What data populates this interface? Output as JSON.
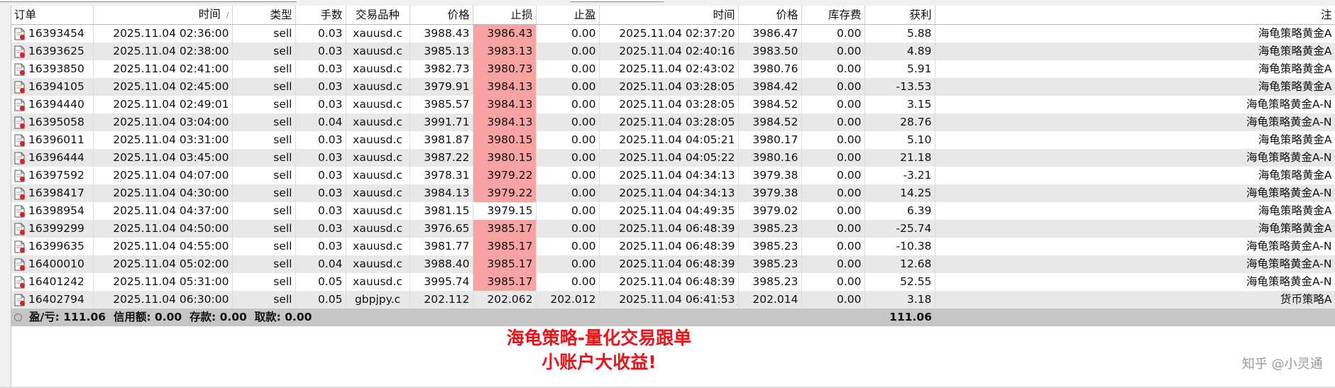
{
  "columns": [
    "订单",
    "时间",
    "类型",
    "手数",
    "交易品种",
    "价格",
    "止损",
    "止盈",
    "时间",
    "价格",
    "库存费",
    "获利",
    "注"
  ],
  "sort_indicator": "/",
  "rows": [
    {
      "order": "16393454",
      "open_time": "2025.11.04 02:36:00",
      "type": "sell",
      "lots": "0.03",
      "symbol": "xauusd.c",
      "open_price": "3988.43",
      "sl": "3986.43",
      "tp": "0.00",
      "close_time": "2025.11.04 02:37:20",
      "close_price": "3986.47",
      "swap": "0.00",
      "profit": "5.88",
      "comment": "海龟策略黄金A",
      "sl_hit": true
    },
    {
      "order": "16393625",
      "open_time": "2025.11.04 02:38:00",
      "type": "sell",
      "lots": "0.03",
      "symbol": "xauusd.c",
      "open_price": "3985.13",
      "sl": "3983.13",
      "tp": "0.00",
      "close_time": "2025.11.04 02:40:16",
      "close_price": "3983.50",
      "swap": "0.00",
      "profit": "4.89",
      "comment": "海龟策略黄金A",
      "sl_hit": true
    },
    {
      "order": "16393850",
      "open_time": "2025.11.04 02:41:00",
      "type": "sell",
      "lots": "0.03",
      "symbol": "xauusd.c",
      "open_price": "3982.73",
      "sl": "3980.73",
      "tp": "0.00",
      "close_time": "2025.11.04 02:43:02",
      "close_price": "3980.76",
      "swap": "0.00",
      "profit": "5.91",
      "comment": "海龟策略黄金A",
      "sl_hit": true
    },
    {
      "order": "16394105",
      "open_time": "2025.11.04 02:45:00",
      "type": "sell",
      "lots": "0.03",
      "symbol": "xauusd.c",
      "open_price": "3979.91",
      "sl": "3984.13",
      "tp": "0.00",
      "close_time": "2025.11.04 03:28:05",
      "close_price": "3984.42",
      "swap": "0.00",
      "profit": "-13.53",
      "comment": "海龟策略黄金A",
      "sl_hit": true
    },
    {
      "order": "16394440",
      "open_time": "2025.11.04 02:49:01",
      "type": "sell",
      "lots": "0.03",
      "symbol": "xauusd.c",
      "open_price": "3985.57",
      "sl": "3984.13",
      "tp": "0.00",
      "close_time": "2025.11.04 03:28:05",
      "close_price": "3984.52",
      "swap": "0.00",
      "profit": "3.15",
      "comment": "海龟策略黄金A-N",
      "sl_hit": true
    },
    {
      "order": "16395058",
      "open_time": "2025.11.04 03:04:00",
      "type": "sell",
      "lots": "0.04",
      "symbol": "xauusd.c",
      "open_price": "3991.71",
      "sl": "3984.13",
      "tp": "0.00",
      "close_time": "2025.11.04 03:28:05",
      "close_price": "3984.52",
      "swap": "0.00",
      "profit": "28.76",
      "comment": "海龟策略黄金A-N",
      "sl_hit": true
    },
    {
      "order": "16396011",
      "open_time": "2025.11.04 03:31:00",
      "type": "sell",
      "lots": "0.03",
      "symbol": "xauusd.c",
      "open_price": "3981.87",
      "sl": "3980.15",
      "tp": "0.00",
      "close_time": "2025.11.04 04:05:21",
      "close_price": "3980.17",
      "swap": "0.00",
      "profit": "5.10",
      "comment": "海龟策略黄金A",
      "sl_hit": true
    },
    {
      "order": "16396444",
      "open_time": "2025.11.04 03:45:00",
      "type": "sell",
      "lots": "0.03",
      "symbol": "xauusd.c",
      "open_price": "3987.22",
      "sl": "3980.15",
      "tp": "0.00",
      "close_time": "2025.11.04 04:05:22",
      "close_price": "3980.16",
      "swap": "0.00",
      "profit": "21.18",
      "comment": "海龟策略黄金A-N",
      "sl_hit": true
    },
    {
      "order": "16397592",
      "open_time": "2025.11.04 04:07:00",
      "type": "sell",
      "lots": "0.03",
      "symbol": "xauusd.c",
      "open_price": "3978.31",
      "sl": "3979.22",
      "tp": "0.00",
      "close_time": "2025.11.04 04:34:13",
      "close_price": "3979.38",
      "swap": "0.00",
      "profit": "-3.21",
      "comment": "海龟策略黄金A",
      "sl_hit": true
    },
    {
      "order": "16398417",
      "open_time": "2025.11.04 04:30:00",
      "type": "sell",
      "lots": "0.03",
      "symbol": "xauusd.c",
      "open_price": "3984.13",
      "sl": "3979.22",
      "tp": "0.00",
      "close_time": "2025.11.04 04:34:13",
      "close_price": "3979.38",
      "swap": "0.00",
      "profit": "14.25",
      "comment": "海龟策略黄金A-N",
      "sl_hit": true
    },
    {
      "order": "16398954",
      "open_time": "2025.11.04 04:37:00",
      "type": "sell",
      "lots": "0.03",
      "symbol": "xauusd.c",
      "open_price": "3981.15",
      "sl": "3979.15",
      "tp": "0.00",
      "close_time": "2025.11.04 04:49:35",
      "close_price": "3979.02",
      "swap": "0.00",
      "profit": "6.39",
      "comment": "海龟策略黄金A",
      "sl_hit": false
    },
    {
      "order": "16399299",
      "open_time": "2025.11.04 04:50:00",
      "type": "sell",
      "lots": "0.03",
      "symbol": "xauusd.c",
      "open_price": "3976.65",
      "sl": "3985.17",
      "tp": "0.00",
      "close_time": "2025.11.04 06:48:39",
      "close_price": "3985.23",
      "swap": "0.00",
      "profit": "-25.74",
      "comment": "海龟策略黄金A",
      "sl_hit": true
    },
    {
      "order": "16399635",
      "open_time": "2025.11.04 04:55:00",
      "type": "sell",
      "lots": "0.03",
      "symbol": "xauusd.c",
      "open_price": "3981.77",
      "sl": "3985.17",
      "tp": "0.00",
      "close_time": "2025.11.04 06:48:39",
      "close_price": "3985.23",
      "swap": "0.00",
      "profit": "-10.38",
      "comment": "海龟策略黄金A-N",
      "sl_hit": true
    },
    {
      "order": "16400010",
      "open_time": "2025.11.04 05:02:00",
      "type": "sell",
      "lots": "0.04",
      "symbol": "xauusd.c",
      "open_price": "3988.40",
      "sl": "3985.17",
      "tp": "0.00",
      "close_time": "2025.11.04 06:48:39",
      "close_price": "3985.23",
      "swap": "0.00",
      "profit": "12.68",
      "comment": "海龟策略黄金A-N",
      "sl_hit": true
    },
    {
      "order": "16401242",
      "open_time": "2025.11.04 05:31:00",
      "type": "sell",
      "lots": "0.05",
      "symbol": "xauusd.c",
      "open_price": "3995.74",
      "sl": "3985.17",
      "tp": "0.00",
      "close_time": "2025.11.04 06:48:39",
      "close_price": "3985.23",
      "swap": "0.00",
      "profit": "52.55",
      "comment": "海龟策略黄金A-N",
      "sl_hit": true
    },
    {
      "order": "16402794",
      "open_time": "2025.11.04 06:30:00",
      "type": "sell",
      "lots": "0.05",
      "symbol": "gbpjpy.c",
      "open_price": "202.112",
      "sl": "202.062",
      "tp": "202.012",
      "close_time": "2025.11.04 06:41:53",
      "close_price": "202.014",
      "swap": "0.00",
      "profit": "3.18",
      "comment": "货币策略A",
      "sl_hit": false
    }
  ],
  "summary": {
    "text": "盈/亏: 111.06  信用额: 0.00  存款: 0.00  取款: 0.00",
    "total_profit": "111.06"
  },
  "promo": {
    "line1": "海龟策略-量化交易跟单",
    "line2": "小账户大收益!"
  },
  "watermark": "知乎 @小灵通",
  "colors": {
    "sl_highlight": "#f7a3a3",
    "promo_text": "#e8141b",
    "row_even": "#e8e8e8",
    "summary_bg": "#c6c6c6"
  },
  "icons": {
    "order_row": "document-with-red-sell-badge-icon"
  }
}
